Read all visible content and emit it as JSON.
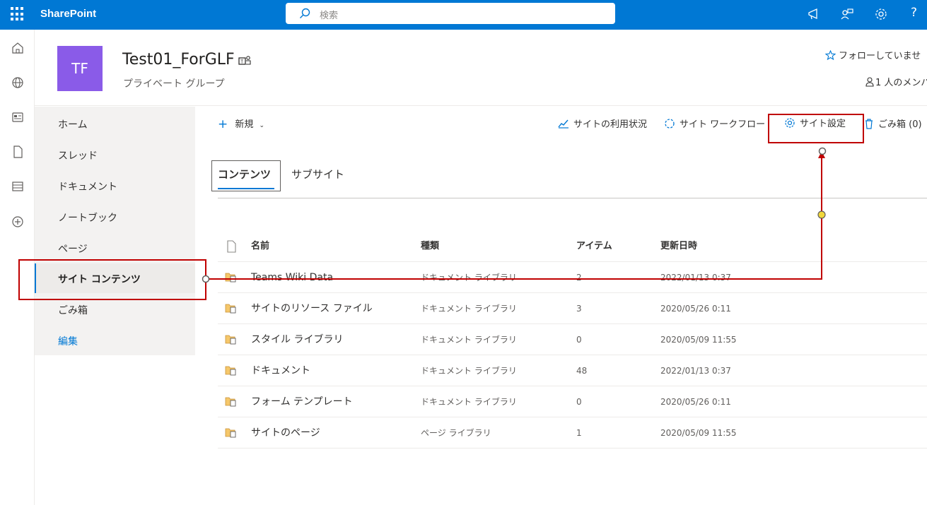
{
  "topbar": {
    "app_name": "SharePoint",
    "search_placeholder": "検索",
    "help_label": "?"
  },
  "site": {
    "logo_initials": "TF",
    "title": "Test01_ForGLF",
    "subtitle": "プライベート グループ",
    "follow_label": "フォローしていませ",
    "members_label": "1 人のメンバ"
  },
  "nav": {
    "items": [
      {
        "label": "ホーム"
      },
      {
        "label": "スレッド"
      },
      {
        "label": "ドキュメント"
      },
      {
        "label": "ノートブック"
      },
      {
        "label": "ページ"
      },
      {
        "label": "サイト コンテンツ",
        "selected": true
      },
      {
        "label": "ごみ箱"
      }
    ],
    "edit_label": "編集"
  },
  "commandbar": {
    "new_label": "新規",
    "usage_label": "サイトの利用状況",
    "workflow_label": "サイト ワークフロー",
    "settings_label": "サイト設定",
    "recycle_label": "ごみ箱 (0)"
  },
  "pivots": {
    "contents_label": "コンテンツ",
    "subsites_label": "サブサイト"
  },
  "table": {
    "headers": {
      "name": "名前",
      "type": "種類",
      "items": "アイテム",
      "modified": "更新日時"
    },
    "rows": [
      {
        "name": "Teams Wiki Data",
        "type": "ドキュメント ライブラリ",
        "items": "2",
        "modified": "2022/01/13 0:37"
      },
      {
        "name": "サイトのリソース ファイル",
        "type": "ドキュメント ライブラリ",
        "items": "3",
        "modified": "2020/05/26 0:11"
      },
      {
        "name": "スタイル ライブラリ",
        "type": "ドキュメント ライブラリ",
        "items": "0",
        "modified": "2020/05/09 11:55"
      },
      {
        "name": "ドキュメント",
        "type": "ドキュメント ライブラリ",
        "items": "48",
        "modified": "2022/01/13 0:37"
      },
      {
        "name": "フォーム テンプレート",
        "type": "ドキュメント ライブラリ",
        "items": "0",
        "modified": "2020/05/26 0:11"
      },
      {
        "name": "サイトのページ",
        "type": "ページ ライブラリ",
        "items": "1",
        "modified": "2020/05/09 11:55"
      }
    ]
  },
  "colors": {
    "brand": "#0078d4",
    "site_logo": "#8a5be8",
    "annotation": "#c00000",
    "annotation_dot": "#f2d83b"
  }
}
